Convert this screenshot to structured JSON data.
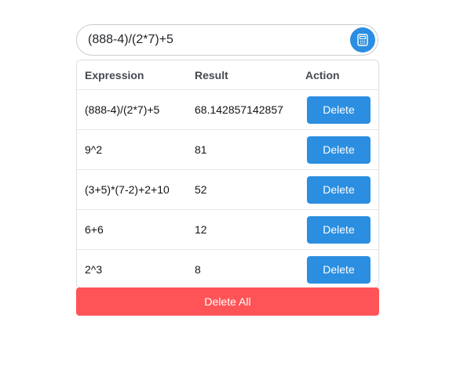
{
  "search": {
    "value": "(888-4)/(2*7)+5",
    "button_icon": "calculator-icon"
  },
  "history": {
    "headers": {
      "expression": "Expression",
      "result": "Result",
      "action": "Action"
    },
    "rows": [
      {
        "expression": "(888-4)/(2*7)+5",
        "result": "68.142857142857",
        "action": "Delete"
      },
      {
        "expression": "9^2",
        "result": "81",
        "action": "Delete"
      },
      {
        "expression": "(3+5)*(7-2)+2+10",
        "result": "52",
        "action": "Delete"
      },
      {
        "expression": "6+6",
        "result": "12",
        "action": "Delete"
      },
      {
        "expression": "2^3",
        "result": "8",
        "action": "Delete"
      }
    ]
  },
  "delete_all_label": "Delete All",
  "colors": {
    "primary": "#2b8ee0",
    "danger": "#fe5457"
  }
}
